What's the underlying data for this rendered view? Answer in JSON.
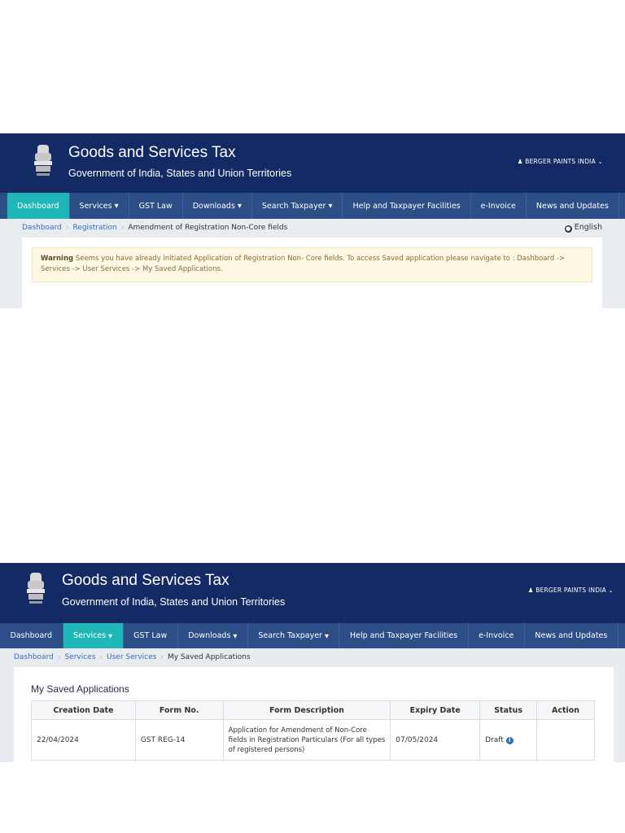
{
  "shot1": {
    "header": {
      "title": "Goods and Services Tax",
      "subtitle": "Government of India, States and Union Territories",
      "user": "BERGER PAINTS INDIA"
    },
    "nav": {
      "items": [
        {
          "label": "Dashboard",
          "active": true,
          "dropdown": false
        },
        {
          "label": "Services",
          "active": false,
          "dropdown": true
        },
        {
          "label": "GST Law",
          "active": false,
          "dropdown": false
        },
        {
          "label": "Downloads",
          "active": false,
          "dropdown": true
        },
        {
          "label": "Search Taxpayer",
          "active": false,
          "dropdown": true
        },
        {
          "label": "Help and Taxpayer Facilities",
          "active": false,
          "dropdown": false
        },
        {
          "label": "e-Invoice",
          "active": false,
          "dropdown": false
        },
        {
          "label": "News and Updates",
          "active": false,
          "dropdown": false
        }
      ]
    },
    "breadcrumb": [
      "Dashboard",
      "Registration",
      "Amendment of Registration Non-Core fields"
    ],
    "language": "English",
    "warning": {
      "label": "Warning",
      "text": "Seems you have already initiated Application of Registration Non- Core fields. To access Saved application please navigate to : Dashboard -> Services -> User Services -> My Saved Applications."
    }
  },
  "shot2": {
    "header": {
      "title": "Goods and Services Tax",
      "subtitle": "Government of India, States and Union Territories",
      "user": "BERGER PAINTS INDIA"
    },
    "nav": {
      "items": [
        {
          "label": "Dashboard",
          "active": false,
          "dropdown": false
        },
        {
          "label": "Services",
          "active": true,
          "dropdown": true
        },
        {
          "label": "GST Law",
          "active": false,
          "dropdown": false
        },
        {
          "label": "Downloads",
          "active": false,
          "dropdown": true
        },
        {
          "label": "Search Taxpayer",
          "active": false,
          "dropdown": true
        },
        {
          "label": "Help and Taxpayer Facilities",
          "active": false,
          "dropdown": false
        },
        {
          "label": "e-Invoice",
          "active": false,
          "dropdown": false
        },
        {
          "label": "News and Updates",
          "active": false,
          "dropdown": false
        }
      ]
    },
    "breadcrumb": [
      "Dashboard",
      "Services",
      "User Services",
      "My Saved Applications"
    ],
    "section_title": "My Saved Applications",
    "table": {
      "columns": [
        "Creation Date",
        "Form No.",
        "Form Description",
        "Expiry Date",
        "Status",
        "Action"
      ],
      "rows": [
        {
          "creation_date": "22/04/2024",
          "form_no": "GST REG-14",
          "description": "Application for Amendment of Non-Core fields in Registration Particulars (For all types of registered persons)",
          "expiry_date": "07/05/2024",
          "status": "Draft",
          "action": ""
        }
      ]
    }
  },
  "colors": {
    "header_bg": "#142a64",
    "nav_bg": "#2c4e86",
    "nav_active": "#1fb6b8",
    "link": "#2f6fb7",
    "warning_bg": "#fcf8e3"
  }
}
